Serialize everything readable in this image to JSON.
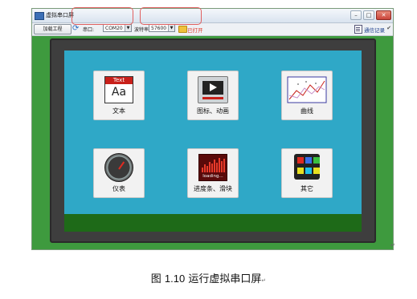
{
  "window": {
    "title": "虚拟串口屏",
    "min": "–",
    "max": "□",
    "close": "✕"
  },
  "toolbar": {
    "load_button": "加载工程",
    "port_label": "串口:",
    "port_value": "COM20",
    "baud_label": "波特率:",
    "baud_value": "57600",
    "status": "已打开",
    "log_label": "通信记录"
  },
  "tiles": [
    {
      "label": "文本",
      "icon": "text-aa-icon",
      "icon_top": "Text",
      "icon_main": "Aa"
    },
    {
      "label": "图标、动画",
      "icon": "media-player-icon"
    },
    {
      "label": "曲线",
      "icon": "line-chart-icon"
    },
    {
      "label": "仪表",
      "icon": "gauge-icon"
    },
    {
      "label": "进度条、滑块",
      "icon": "loading-bar-icon",
      "icon_text": "loading..."
    },
    {
      "label": "其它",
      "icon": "color-grid-icon"
    }
  ],
  "caption": {
    "prefix": "图",
    "number": "1.10",
    "text": "运行虚拟串口屏"
  },
  "colors": {
    "app_background": "#3e9a3e",
    "screen_background": "#2fa8c7",
    "screen_bar": "#1e6a18",
    "status_text": "#e03a2a",
    "highlight": "#e06060"
  }
}
